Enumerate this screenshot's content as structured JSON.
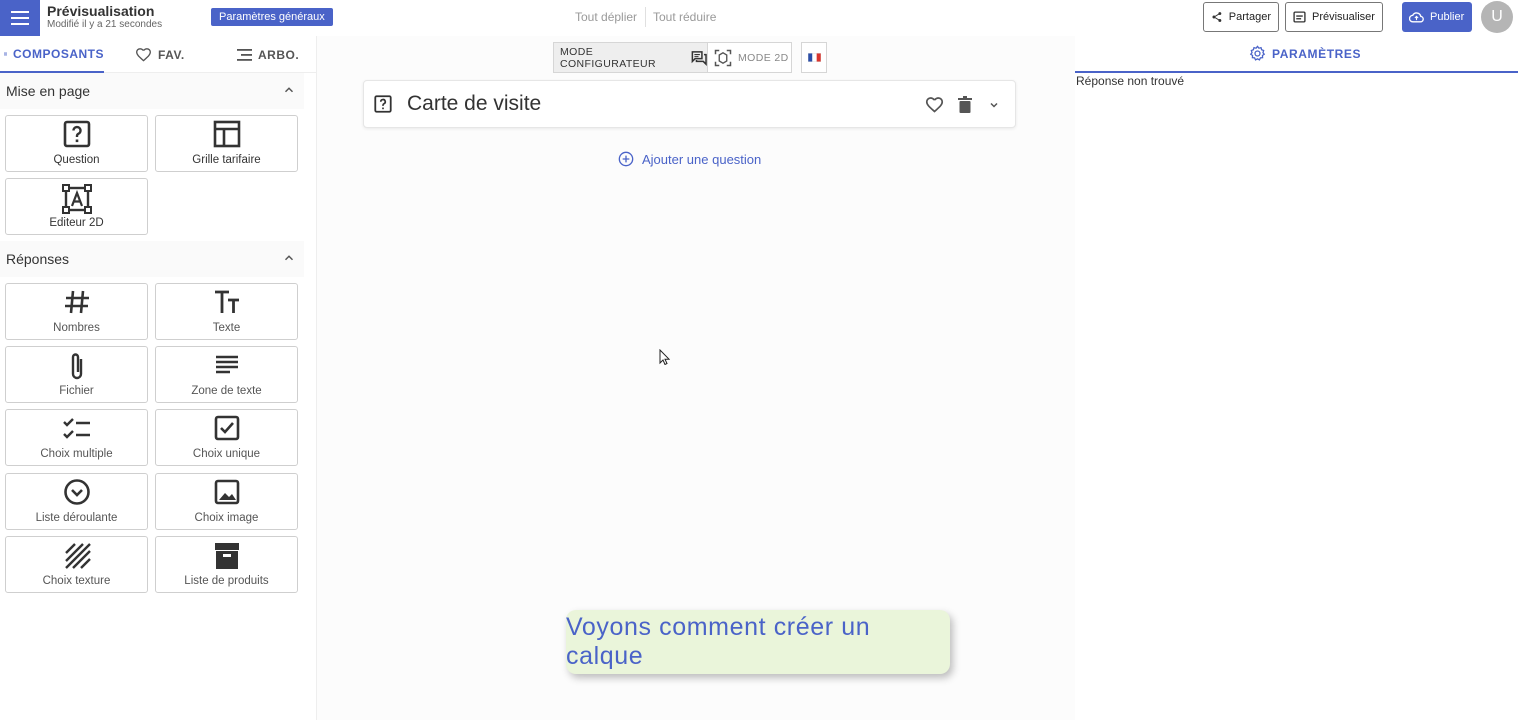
{
  "header": {
    "title": "Prévisualisation",
    "subtitle": "Modifié il y a 21 secondes",
    "general_params": "Paramètres généraux",
    "expand_all": "Tout déplier",
    "collapse_all": "Tout réduire",
    "share": "Partager",
    "preview": "Prévisualiser",
    "publish": "Publier",
    "avatar_initial": "U",
    "accent_color": "#4a63c8"
  },
  "left_panel": {
    "tabs": [
      {
        "label": "COMPOSANTS",
        "icon": "grid-icon"
      },
      {
        "label": "FAV.",
        "icon": "heart-icon"
      },
      {
        "label": "ARBO.",
        "icon": "tree-list-icon"
      }
    ],
    "sections": [
      {
        "title": "Mise en page",
        "items": [
          {
            "label": "Question",
            "icon": "question-box-icon"
          },
          {
            "label": "Grille tarifaire",
            "icon": "table-grid-icon"
          },
          {
            "label": "Editeur 2D",
            "icon": "text-frame-icon"
          }
        ]
      },
      {
        "title": "Réponses",
        "items": [
          {
            "label": "Nombres",
            "icon": "hash-icon"
          },
          {
            "label": "Texte",
            "icon": "text-size-icon"
          },
          {
            "label": "Fichier",
            "icon": "paperclip-icon"
          },
          {
            "label": "Zone de texte",
            "icon": "lines-icon"
          },
          {
            "label": "Choix multiple",
            "icon": "checklist-icon"
          },
          {
            "label": "Choix unique",
            "icon": "checkbox-icon"
          },
          {
            "label": "Liste déroulante",
            "icon": "dropdown-circle-icon"
          },
          {
            "label": "Choix image",
            "icon": "image-icon"
          },
          {
            "label": "Choix texture",
            "icon": "texture-icon"
          },
          {
            "label": "Liste de produits",
            "icon": "archive-box-icon"
          }
        ]
      }
    ]
  },
  "canvas": {
    "mode_configurator": "MODE CONFIGURATEUR",
    "mode_2d": "MODE 2D",
    "page_title": "Carte de visite",
    "add_question": "Ajouter une question",
    "tooltip": "Voyons comment créer un calque"
  },
  "right_panel": {
    "tab": "PARAMÈTRES",
    "not_found": "Réponse non trouvé"
  }
}
